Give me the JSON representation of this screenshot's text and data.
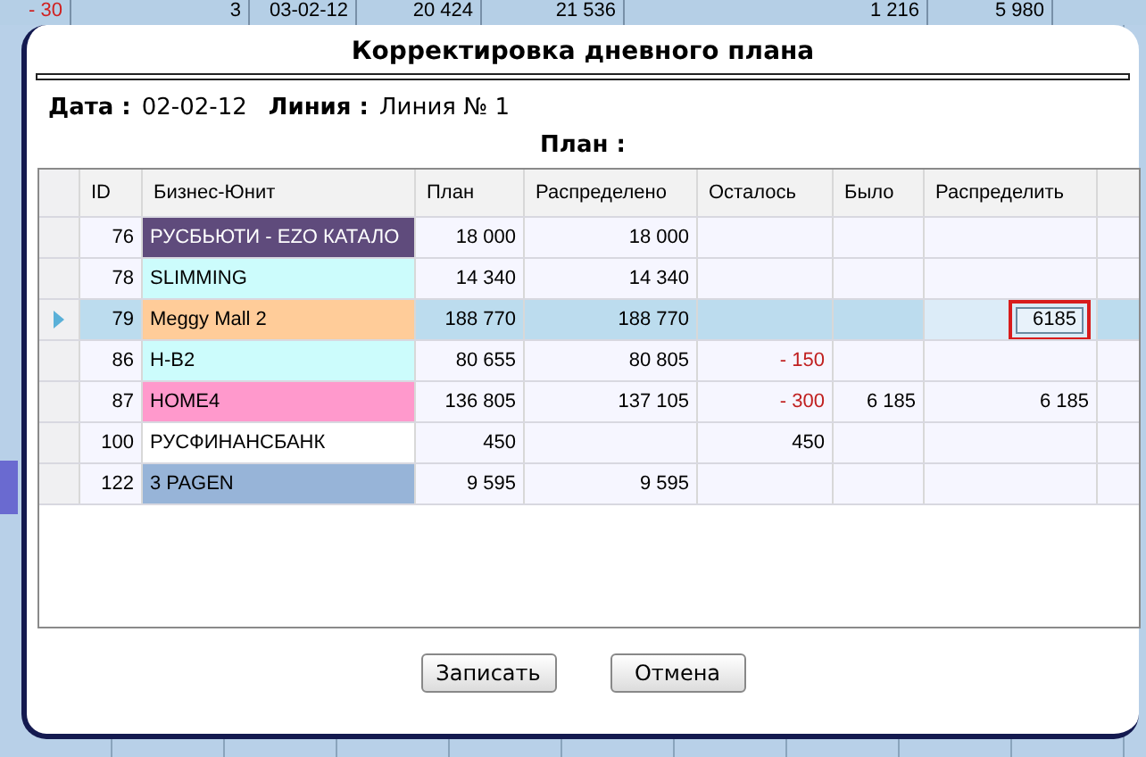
{
  "background_row": [
    {
      "text": "- 30",
      "negative": true
    },
    {
      "text": "3",
      "negative": false
    },
    {
      "text": "03-02-12",
      "negative": false
    },
    {
      "text": "20 424",
      "negative": false
    },
    {
      "text": "21 536",
      "negative": false
    },
    {
      "text": "1 216",
      "negative": false
    },
    {
      "text": "5 980",
      "negative": false
    }
  ],
  "dialog": {
    "title": "Корректировка дневного плана",
    "date_label": "Дата :",
    "date": "02-02-12",
    "line_label": "Линия :",
    "line": "Линия № 1",
    "plan_label": "План :"
  },
  "table": {
    "columns": [
      "ID",
      "Бизнес-Юнит",
      "План",
      "Распределено",
      "Осталось",
      "Было",
      "Распределить"
    ],
    "rows": [
      {
        "selected": false,
        "id": "76",
        "unit": "РУСБЬЮТИ - EZO КАТАЛО",
        "color": "#5f4b7c",
        "plan": "18 000",
        "distributed": "18 000"
      },
      {
        "selected": false,
        "id": "78",
        "unit": "SLIMMING",
        "color": "#ccfcfc",
        "plan": "14 340",
        "distributed": "14 340"
      },
      {
        "selected": true,
        "id": "79",
        "unit": "Meggy Mall 2",
        "color": "#ffcc99",
        "plan": "188 770",
        "distributed": "188 770",
        "editing": {
          "value": "6185",
          "highlighted": true
        }
      },
      {
        "selected": false,
        "id": "86",
        "unit": "H-B2",
        "color": "#ccfcfc",
        "plan": "80 655",
        "distributed": "80 805",
        "remaining": "- 150",
        "remaining_negative": true
      },
      {
        "selected": false,
        "id": "87",
        "unit": "HOME4",
        "color": "#ff99cc",
        "plan": "136 805",
        "distributed": "137 105",
        "remaining": "- 300",
        "remaining_negative": true,
        "was": "6 185",
        "distribute": "6 185"
      },
      {
        "selected": false,
        "id": "100",
        "unit": "РУСФИНАНСБАНК",
        "color": "#ffffff",
        "plan": "450",
        "remaining": "450",
        "remaining_negative": false
      },
      {
        "selected": false,
        "id": "122",
        "unit": "3 PAGEN",
        "color": "#97b4d8",
        "plan": "9 595",
        "distributed": "9 595"
      }
    ]
  },
  "buttons": [
    "Записать",
    "Отмена"
  ]
}
